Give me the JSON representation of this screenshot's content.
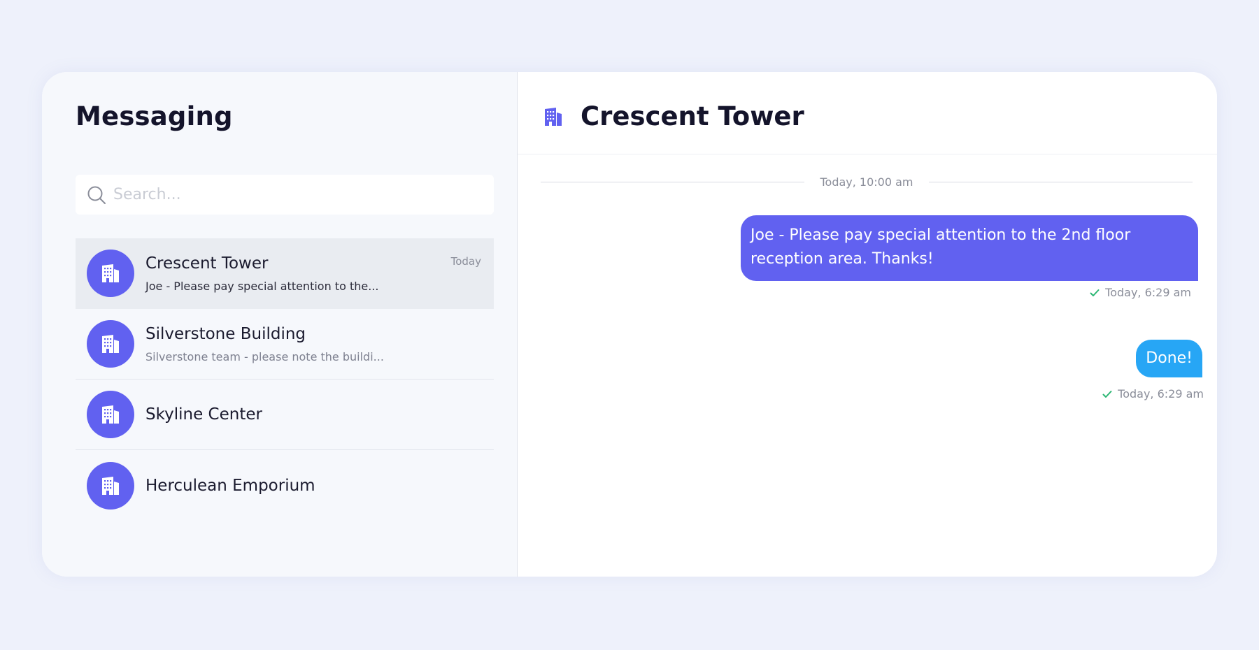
{
  "left": {
    "title": "Messaging",
    "search_placeholder": "Search..."
  },
  "conversations": [
    {
      "name": "Crescent Tower",
      "preview": "Joe - Please pay special attention to the...",
      "time": "Today",
      "active": true
    },
    {
      "name": "Silverstone Building",
      "preview": "Silverstone team - please note the buildi...",
      "time": "",
      "active": false
    },
    {
      "name": "Skyline Center",
      "preview": "",
      "time": "",
      "active": false
    },
    {
      "name": "Herculean Emporium",
      "preview": "",
      "time": "",
      "active": false
    }
  ],
  "chat": {
    "title": "Crescent Tower",
    "date_divider": "Today, 10:00 am",
    "messages": [
      {
        "text": "Joe - Please pay special attention to the 2nd floor reception area. Thanks!",
        "time": "Today, 6:29 am"
      },
      {
        "text": "Done!",
        "time": "Today, 6:29 am"
      }
    ]
  },
  "colors": {
    "accent": "#6161f0",
    "secondary_bubble": "#27a6f5",
    "check": "#2bb673",
    "page_bg": "#eef1fb"
  },
  "icons": {
    "search": "search-icon",
    "avatar": "building-icon",
    "header": "building-icon",
    "read_receipt": "check-icon"
  }
}
